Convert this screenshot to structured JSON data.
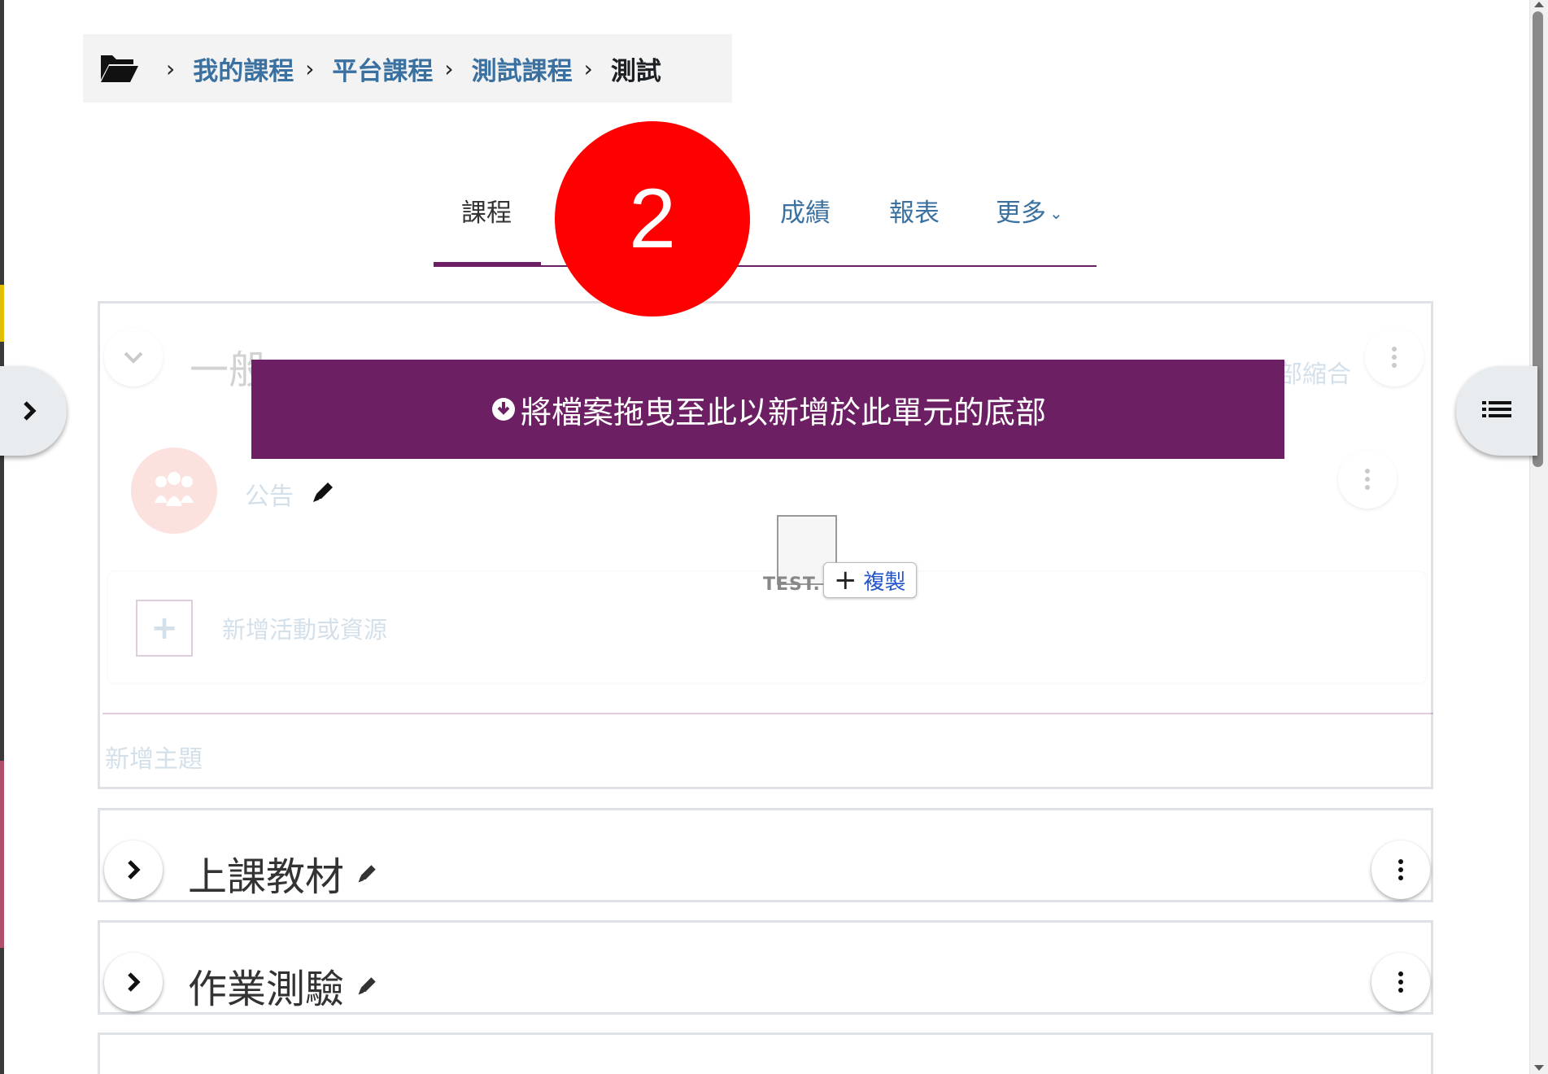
{
  "breadcrumb": {
    "items": [
      "我的課程",
      "平台課程",
      "測試課程"
    ],
    "current": "測試"
  },
  "tabs": [
    {
      "label": "課程",
      "active": true
    },
    {
      "label": "成績",
      "active": false
    },
    {
      "label": "報表",
      "active": false
    },
    {
      "label": "更多",
      "active": false
    }
  ],
  "step_badge": "2",
  "general_section": {
    "title_partial": "一般",
    "collapse_all_partial": "部縮合",
    "announcement_label": "公告",
    "add_activity_label": "新增活動或資源",
    "add_topic_label": "新增主題"
  },
  "dropzone": {
    "text": "將檔案拖曳至此以新增於此單元的底部"
  },
  "drag_ghost": {
    "filename_partial": "TEST.",
    "copy_label": "複製"
  },
  "sections": [
    {
      "title": "上課教材"
    },
    {
      "title": "作業測驗"
    }
  ],
  "colors": {
    "brand": "#6d1f64",
    "link": "#3a71a0",
    "badge": "#fe0000"
  }
}
